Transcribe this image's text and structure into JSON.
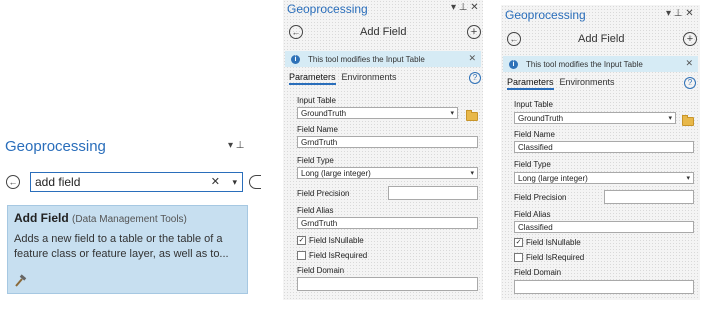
{
  "search_panel": {
    "title": "Geoprocessing",
    "pin_controls": "▾ ⊥",
    "search_value": "add field",
    "clear_glyph": "✕",
    "dropdown_glyph": "▾",
    "result": {
      "name": "Add Field",
      "toolbox": "(Data Management Tools)",
      "description": "Adds a new field to a table or the table of a feature class or feature layer, as well as to..."
    }
  },
  "panels": [
    {
      "title": "Geoprocessing",
      "tool_title": "Add Field",
      "info_text": "This tool modifies the Input Table",
      "tabs": {
        "parameters": "Parameters",
        "environments": "Environments"
      },
      "input_table_label": "Input Table",
      "input_table_value": "GroundTruth",
      "field_name_label": "Field Name",
      "field_name_value": "GrndTruth",
      "field_type_label": "Field Type",
      "field_type_value": "Long (large integer)",
      "field_precision_label": "Field Precision",
      "field_precision_value": "",
      "field_alias_label": "Field Alias",
      "field_alias_value": "GrndTruth",
      "nullable_label": "Field IsNullable",
      "nullable_checked": true,
      "required_label": "Field IsRequired",
      "required_checked": false,
      "domain_label": "Field Domain",
      "domain_value": ""
    },
    {
      "title": "Geoprocessing",
      "tool_title": "Add Field",
      "info_text": "This tool modifies the Input Table",
      "tabs": {
        "parameters": "Parameters",
        "environments": "Environments"
      },
      "input_table_label": "Input Table",
      "input_table_value": "GroundTruth",
      "field_name_label": "Field Name",
      "field_name_value": "Classified",
      "field_type_label": "Field Type",
      "field_type_value": "Long (large integer)",
      "field_precision_label": "Field Precision",
      "field_precision_value": "",
      "field_alias_label": "Field Alias",
      "field_alias_value": "Classified",
      "nullable_label": "Field IsNullable",
      "nullable_checked": true,
      "required_label": "Field IsRequired",
      "required_checked": false,
      "domain_label": "Field Domain",
      "domain_value": ""
    }
  ],
  "icons": {
    "back": "back-arrow-icon",
    "add": "plus-icon",
    "info": "info-icon",
    "help": "help-icon",
    "folder": "folder-icon",
    "hammer": "hammer-icon"
  },
  "colors": {
    "accent": "#2a6ebb",
    "info_bar": "#d6ebf5",
    "result_bg": "#c7dff0"
  }
}
